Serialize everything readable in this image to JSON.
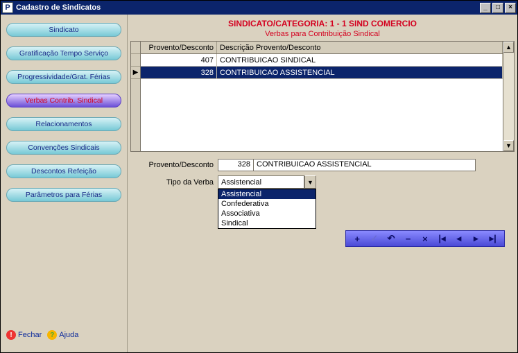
{
  "window": {
    "title": "Cadastro de Sindicatos"
  },
  "sidebar": {
    "items": [
      {
        "label": "Sindicato"
      },
      {
        "label": "Gratificação Tempo Serviço"
      },
      {
        "label": "Progressividade/Grat. Férias"
      },
      {
        "label": "Verbas Contrib. Sindical"
      },
      {
        "label": "Relacionamentos"
      },
      {
        "label": "Convenções Sindicais"
      },
      {
        "label": "Descontos Refeição"
      },
      {
        "label": "Parâmetros para Férias"
      }
    ],
    "active_index": 3
  },
  "footer": {
    "fechar": "Fechar",
    "ajuda": "Ajuda"
  },
  "header": {
    "category_line": "SINDICATO/CATEGORIA: 1 - 1 SIND COMERCIO",
    "section_line": "Verbas para Contribuição Sindical"
  },
  "grid": {
    "columns": [
      "Provento/Desconto",
      "Descrição Provento/Desconto"
    ],
    "rows": [
      {
        "code": "407",
        "desc": "CONTRIBUICAO SINDICAL",
        "selected": false
      },
      {
        "code": "328",
        "desc": "CONTRIBUICAO ASSISTENCIAL",
        "selected": true
      }
    ]
  },
  "form": {
    "provento_label": "Provento/Desconto",
    "provento_code": "328",
    "provento_desc": "CONTRIBUICAO ASSISTENCIAL",
    "tipo_label": "Tipo da Verba",
    "tipo_selected": "Assistencial",
    "tipo_options": [
      "Assistencial",
      "Confederativa",
      "Associativa",
      "Sindical"
    ]
  },
  "nav": {
    "add": "+",
    "ok": "✓",
    "undo": "↶",
    "minus": "−",
    "cancel": "×",
    "first": "|◂",
    "prev": "◂",
    "next": "▸",
    "last": "▸|"
  }
}
